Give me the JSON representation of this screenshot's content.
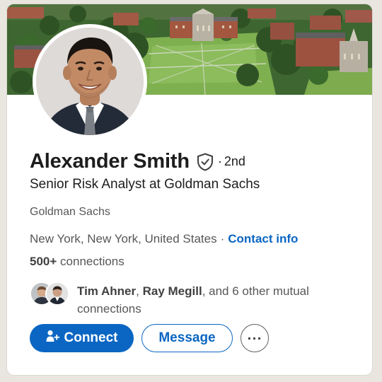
{
  "profile": {
    "name": "Alexander Smith",
    "degree": "2nd",
    "degree_separator": "·",
    "verified_icon": "shield-check-icon",
    "headline": "Senior Risk Analyst at Goldman Sachs",
    "company": "Goldman Sachs",
    "location": "New York, New York, United States",
    "location_separator": "·",
    "contact_info_label": "Contact info",
    "connections_count": "500+",
    "connections_label": "connections"
  },
  "mutual": {
    "name_1": "Tim Ahner",
    "comma": ",",
    "name_2": "Ray Megill",
    "rest": ", and 6 other mutual connections"
  },
  "actions": {
    "connect_label": "Connect",
    "connect_icon": "add-person-icon",
    "message_label": "Message",
    "more_label": "···"
  },
  "colors": {
    "accent": "#0a66c2",
    "text_primary": "#1d1d1d",
    "text_secondary": "#575757"
  }
}
